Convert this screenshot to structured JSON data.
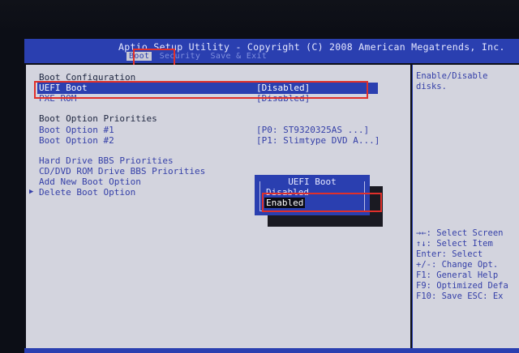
{
  "title": "Aptio Setup Utility - Copyright (C) 2008 American Megatrends, Inc.",
  "tabs": [
    "Boot",
    "Security",
    "Save & Exit"
  ],
  "active_tab": "Boot",
  "main": {
    "boot_configuration_heading": "Boot Configuration",
    "uefi_boot_label": "UEFI Boot",
    "uefi_boot_value": "[Disabled]",
    "pxe_rom_label": "PXE ROM",
    "pxe_rom_value": "[Disabled]",
    "boot_option_priorities_heading": "Boot Option Priorities",
    "boot_option_1_label": "Boot Option #1",
    "boot_option_1_value": "[P0: ST9320325AS    ...]",
    "boot_option_2_label": "Boot Option #2",
    "boot_option_2_value": "[P1: Slimtype DVD A...]",
    "hdd_bbs_label": "Hard Drive BBS Priorities",
    "cd_bbs_label": "CD/DVD ROM Drive BBS Priorities",
    "add_boot_label": "Add New Boot Option",
    "delete_boot_label": "Delete Boot Option"
  },
  "help": {
    "description": [
      "Enable/Disable",
      "disks."
    ],
    "keys": [
      "→←: Select Screen",
      "↑↓: Select Item",
      "Enter: Select",
      "+/-: Change Opt.",
      "F1: General Help",
      "F9: Optimized Defa",
      "F10: Save  ESC: Ex"
    ]
  },
  "popup": {
    "title": "UEFI Boot",
    "options": [
      "Disabled",
      "Enabled"
    ],
    "selected": "Enabled"
  },
  "colors": {
    "bios_blue": "#2a3fb0",
    "panel_gray": "#d3d4de",
    "highlight_red": "#e0302a"
  }
}
